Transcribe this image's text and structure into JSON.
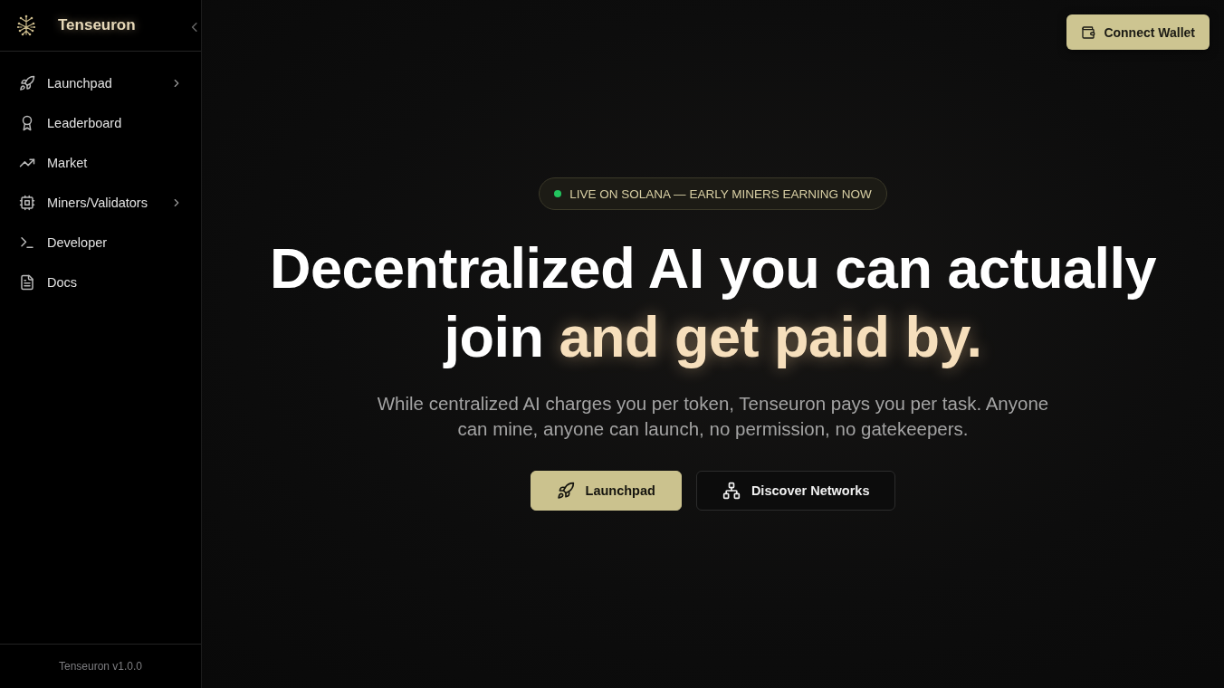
{
  "sidebar": {
    "brand": "Tenseuron",
    "nav": [
      {
        "label": "Launchpad",
        "has_submenu": true,
        "selected": false
      },
      {
        "label": "Leaderboard",
        "has_submenu": false,
        "selected": false
      },
      {
        "label": "Market",
        "has_submenu": false,
        "selected": false
      },
      {
        "label": "Miners/Validators",
        "has_submenu": true,
        "selected": false
      },
      {
        "label": "Developer",
        "has_submenu": false,
        "selected": false
      },
      {
        "label": "Docs",
        "has_submenu": false,
        "selected": false
      }
    ],
    "footer": "Tenseuron v1.0.0"
  },
  "header": {
    "connect_button": "Connect Wallet"
  },
  "hero": {
    "badge": {
      "text": "LIVE ON SOLANA — EARLY MINERS EARNING NOW",
      "live": true
    },
    "headline": [
      {
        "text": "Decentralized AI you can actually join",
        "highlight": false
      },
      {
        "text": "and get paid by.",
        "highlight": true
      }
    ],
    "subtitle": "While centralized AI charges you per token, Tenseuron pays you per task. Anyone can mine, anyone can launch, no permission, no gatekeepers.",
    "buttons": [
      {
        "label": "Launchpad",
        "kind": "primary"
      },
      {
        "label": "Discover Networks",
        "kind": "secondary"
      }
    ]
  }
}
